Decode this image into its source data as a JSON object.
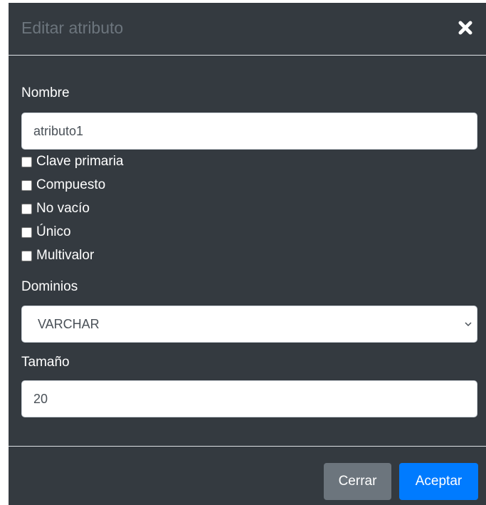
{
  "dialog": {
    "title": "Editar atributo",
    "close_icon": "close-icon"
  },
  "form": {
    "name_label": "Nombre",
    "name_value": "atributo1",
    "checkboxes": [
      {
        "label": "Clave primaria",
        "checked": false
      },
      {
        "label": "Compuesto",
        "checked": false
      },
      {
        "label": "No vacío",
        "checked": false
      },
      {
        "label": "Único",
        "checked": false
      },
      {
        "label": "Multivalor",
        "checked": false
      }
    ],
    "domain_label": "Dominios",
    "domain_value": "VARCHAR",
    "size_label": "Tamaño",
    "size_value": "20"
  },
  "footer": {
    "cancel_label": "Cerrar",
    "accept_label": "Aceptar"
  },
  "colors": {
    "dialog_bg": "#343a40",
    "title_text": "#6c757d",
    "secondary_button": "#6c757d",
    "primary_button": "#007bff",
    "divider": "#dee2e6"
  }
}
